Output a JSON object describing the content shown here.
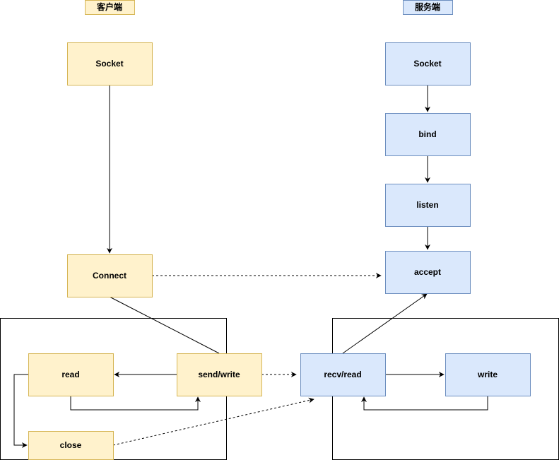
{
  "colors": {
    "client_fill": "#fff2cc",
    "client_stroke": "#d6b656",
    "server_fill": "#dae8fc",
    "server_stroke": "#6c8ebf"
  },
  "client": {
    "title": "客户端",
    "socket": "Socket",
    "connect": "Connect",
    "read": "read",
    "send_write": "send/write",
    "close": "close"
  },
  "server": {
    "title": "服务端",
    "socket": "Socket",
    "bind": "bind",
    "listen": "listen",
    "accept": "accept",
    "recv_read": "recv/read",
    "write": "write"
  }
}
